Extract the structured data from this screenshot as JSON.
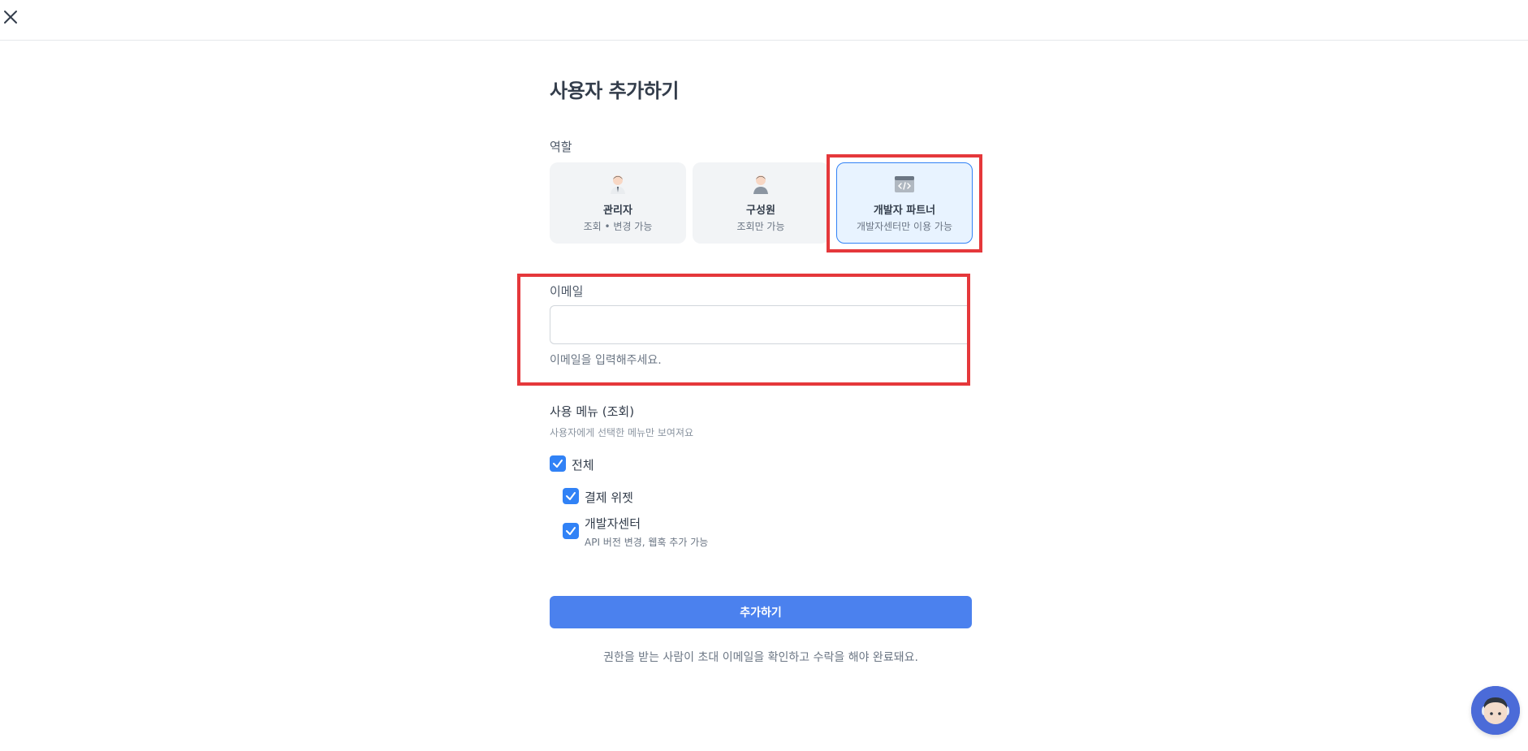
{
  "header": {
    "close_icon": "close-icon"
  },
  "page": {
    "title": "사용자 추가하기"
  },
  "role": {
    "label": "역할",
    "options": [
      {
        "title": "관리자",
        "desc": "조회 • 변경 가능",
        "icon": "admin-avatar-icon",
        "selected": false
      },
      {
        "title": "구성원",
        "desc": "조회만 가능",
        "icon": "member-avatar-icon",
        "selected": false
      },
      {
        "title": "개발자 파트너",
        "desc": "개발자센터만 이용 가능",
        "icon": "code-window-icon",
        "selected": true
      }
    ]
  },
  "email": {
    "label": "이메일",
    "value": "",
    "placeholder": "",
    "help": "이메일을 입력해주세요."
  },
  "menu": {
    "label": "사용 메뉴 (조회)",
    "sub": "사용자에게 선택한 메뉴만 보여져요",
    "items": [
      {
        "label": "전체",
        "checked": true
      },
      {
        "label": "결제 위젯",
        "checked": true
      },
      {
        "label": "개발자센터",
        "desc": "API 버전 변경, 웹훅 추가 가능",
        "checked": true
      }
    ]
  },
  "actions": {
    "submit_label": "추가하기",
    "note": "권한을 받는 사람이 초대 이메일을 확인하고 수락을 해야 완료돼요."
  },
  "colors": {
    "primary": "#3182f6",
    "button": "#4b81ee",
    "highlight": "#e5383b",
    "selected_bg": "#e8f3ff"
  },
  "support": {
    "icon": "support-agent-icon"
  }
}
